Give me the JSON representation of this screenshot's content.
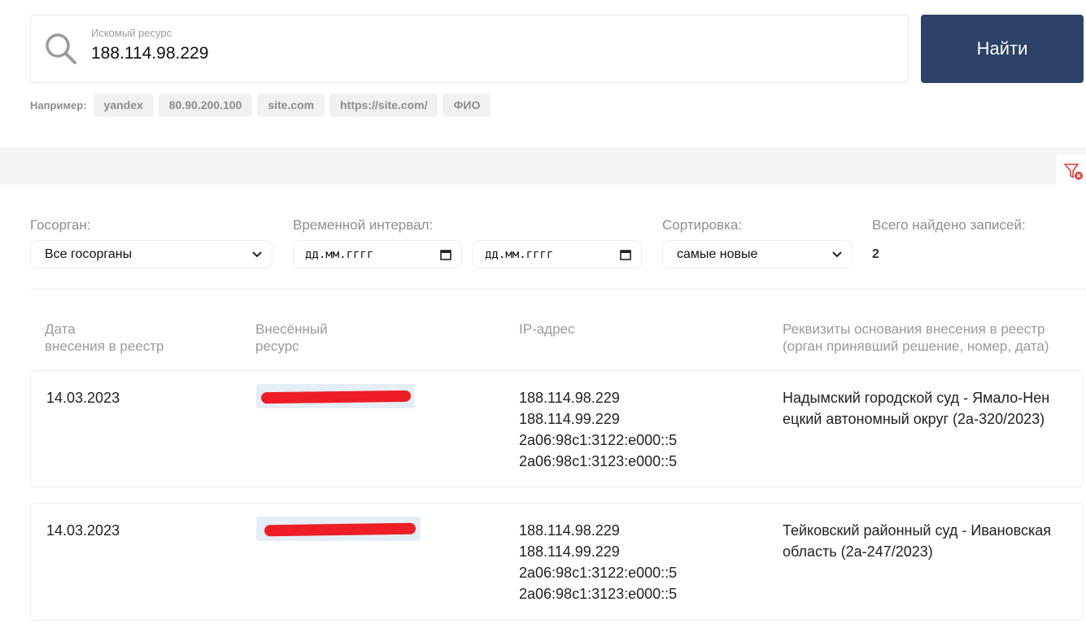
{
  "search": {
    "label": "Искомый ресурс",
    "value": "188.114.98.229",
    "button_label": "Найти",
    "examples_label": "Например:",
    "examples": [
      "yandex",
      "80.90.200.100",
      "site.com",
      "https://site.com/",
      "ФИО"
    ]
  },
  "filters": {
    "agency_label": "Госорган:",
    "agency_value": "Все госорганы",
    "interval_label": "Временной интервал:",
    "date_from_placeholder": "дд.мм.гггг",
    "date_to_placeholder": "дд.мм.гггг",
    "sort_label": "Сортировка:",
    "sort_value": "самые новые",
    "total_label": "Всего найдено записей:",
    "total_value": "2"
  },
  "icons": {
    "search": "search-icon",
    "filter_reset": "filter-reset-icon",
    "dropdown": "chevron-down-icon",
    "calendar": "calendar-icon"
  },
  "colors": {
    "primary_button": "#2c4268",
    "redaction": "#ee1e26"
  },
  "table": {
    "headers": {
      "date": [
        "Дата",
        "внесения в реестр"
      ],
      "resource": [
        "Внесённый",
        "ресурс"
      ],
      "ip": [
        "IP-адрес"
      ],
      "basis": [
        "Реквизиты основания внесения в реестр",
        "(орган принявший решение, номер, дата)"
      ]
    },
    "rows": [
      {
        "date": "14.03.2023",
        "resource": "",
        "ips": [
          "188.114.98.229",
          "188.114.99.229",
          "2a06:98c1:3122:e000::5",
          "2a06:98c1:3123:e000::5"
        ],
        "basis": [
          "Надымский городской суд - Ямало-Нен",
          "ецкий автономный округ (2а-320/2023)"
        ]
      },
      {
        "date": "14.03.2023",
        "resource": "",
        "ips": [
          "188.114.98.229",
          "188.114.99.229",
          "2a06:98c1:3122:e000::5",
          "2a06:98c1:3123:e000::5"
        ],
        "basis": [
          "Тейковский районный суд - Ивановская",
          "область (2а-247/2023)"
        ]
      }
    ]
  }
}
